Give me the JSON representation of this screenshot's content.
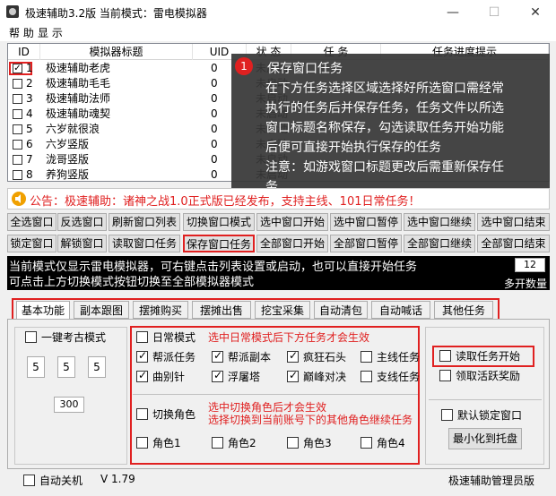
{
  "window": {
    "title": "极速辅助3.2版    当前模式：雷电模拟器",
    "minimize": "—",
    "maximize": "☐",
    "close": "✕"
  },
  "menu": [
    "帮 助",
    "显 示"
  ],
  "list": {
    "headers": [
      "ID",
      "模拟器标题",
      "UID",
      "状 态",
      "任 务",
      "任务进度提示"
    ],
    "rows": [
      {
        "id": "1",
        "title": "极速辅助老虎",
        "uid": "0",
        "status": "未启动",
        "checked": true
      },
      {
        "id": "2",
        "title": "极速辅助毛毛",
        "uid": "0",
        "status": "未启动",
        "checked": false
      },
      {
        "id": "3",
        "title": "极速辅助法师",
        "uid": "0",
        "status": "未启动",
        "checked": false
      },
      {
        "id": "4",
        "title": "极速辅助魂契",
        "uid": "0",
        "status": "未启动",
        "checked": false
      },
      {
        "id": "5",
        "title": "六岁就很浪",
        "uid": "0",
        "status": "未启动",
        "checked": false
      },
      {
        "id": "6",
        "title": "六岁竖版",
        "uid": "0",
        "status": "未启动",
        "checked": false
      },
      {
        "id": "7",
        "title": "泷哥竖版",
        "uid": "0",
        "status": "未启动",
        "checked": false
      },
      {
        "id": "8",
        "title": "养狗竖版",
        "uid": "0",
        "status": "未启动",
        "checked": false
      }
    ]
  },
  "callout": {
    "badge": "1",
    "lines": [
      "保存窗口任务",
      "在下方任务选择区域选择好所选窗口需经常",
      "执行的任务后并保存任务，任务文件以所选",
      "窗口标题名称保存，勾选读取任务开始功能",
      "后便可直接开始执行保存的任务",
      "注意：如游戏窗口标题更改后需重新保存任",
      "务"
    ]
  },
  "announcement": "公告：极速辅助：诸神之战1.0正式版已经发布，支持主线、101日常任务！",
  "buttons_row1": [
    "全选窗口",
    "反选窗口",
    "刷新窗口列表",
    "切换窗口模式",
    "选中窗口开始",
    "选中窗口暂停",
    "选中窗口继续",
    "选中窗口结束"
  ],
  "buttons_row2": [
    "锁定窗口",
    "解锁窗口",
    "读取窗口任务",
    "保存窗口任务",
    "全部窗口开始",
    "全部窗口暂停",
    "全部窗口继续",
    "全部窗口结束"
  ],
  "status": {
    "line1": "当前模式仅显示雷电模拟器，可右键点击列表设置或启动，也可以直接开始任务",
    "line2": "可点击上方切换模式按钮切换至全部模拟器模式",
    "count": "12",
    "multi_label": "多开数量"
  },
  "tabs": [
    "基本功能",
    "副本跟图",
    "摆摊购买",
    "摆摊出售",
    "挖宝采集",
    "自动清包",
    "自动喊话",
    "其他任务"
  ],
  "left_panel": {
    "exam_label": "一键考古模式",
    "nums": [
      "5",
      "5",
      "5"
    ],
    "num2": "300"
  },
  "daily": {
    "mode_label": "日常模式",
    "note": "选中日常模式后下方任务才会生效",
    "tasks": [
      {
        "label": "帮派任务",
        "checked": true
      },
      {
        "label": "帮派副本",
        "checked": true
      },
      {
        "label": "疯狂石头",
        "checked": true
      },
      {
        "label": "主线任务",
        "checked": false
      },
      {
        "label": "曲别针",
        "checked": true
      },
      {
        "label": "浮屠塔",
        "checked": true
      },
      {
        "label": "巅峰对决",
        "checked": true
      },
      {
        "label": "支线任务",
        "checked": false
      }
    ]
  },
  "roles": {
    "switch_label": "切换角色",
    "note1": "选中切换角色后才会生效",
    "note2": "选择切换到当前账号下的其他角色继续任务",
    "items": [
      "角色1",
      "角色2",
      "角色3",
      "角色4"
    ]
  },
  "right_panel": {
    "read_task": "读取任务开始",
    "claim": "领取活跃奖励",
    "lock_default": "默认锁定窗口",
    "minimize_tray": "最小化到托盘"
  },
  "footer": {
    "auto_shutdown": "自动关机",
    "version": "V 1.79",
    "edition": "极速辅助管理员版"
  }
}
